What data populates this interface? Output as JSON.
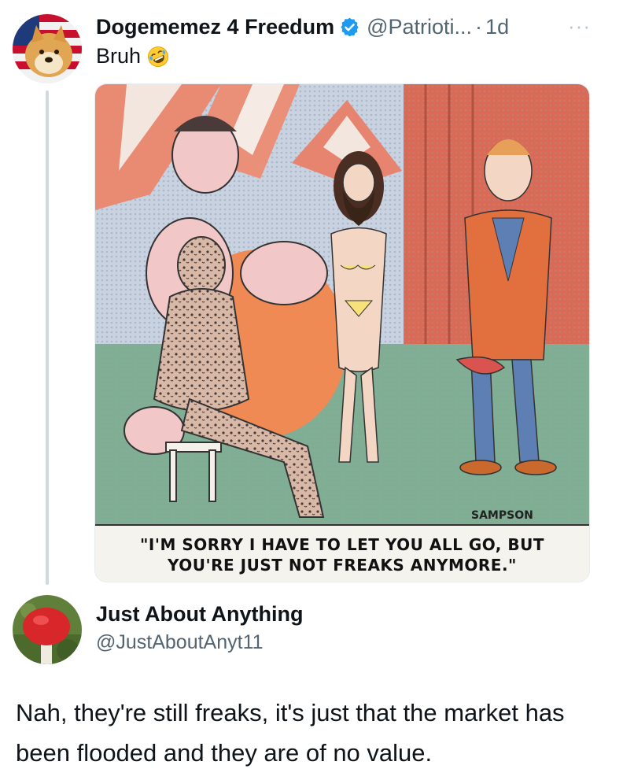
{
  "post": {
    "display_name": "Dogememez 4 Freedum",
    "handle": "@Patrioti...",
    "separator": "·",
    "time": "1d",
    "more": "···",
    "text": "Bruh",
    "emoji": "rolling-on-floor-laughing",
    "avatar": "doge-with-flag-avatar",
    "verified": true
  },
  "comic": {
    "signature": "SAMPSON",
    "caption_line1": "\"I'M SORRY I HAVE TO LET YOU ALL GO, BUT",
    "caption_line2": "YOU'RE JUST NOT FREAKS ANYMORE.\""
  },
  "reply": {
    "display_name": "Just About Anything",
    "handle": "@JustAboutAnyt11",
    "avatar": "red-mushroom-avatar",
    "text": "Nah, they're still freaks, it's just that the market has been flooded and they are of no value."
  },
  "colors": {
    "verified": "#1d9bf0",
    "secondary_text": "#536471",
    "thread_line": "#cfd9de"
  }
}
